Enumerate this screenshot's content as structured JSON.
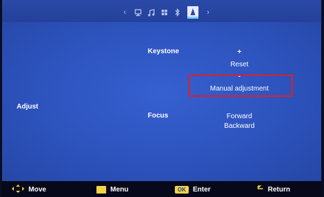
{
  "colors": {
    "background": "#2d53bd",
    "highlight_border": "#e01e28",
    "key_yellow": "#f4d24a"
  },
  "topbar": {
    "icons": [
      "left-arrow-icon",
      "monitor-icon",
      "music-note-icon",
      "grid-icon",
      "bluetooth-icon",
      "projector-icon",
      "right-arrow-icon"
    ],
    "left_arrow": "‹",
    "right_arrow": "›"
  },
  "panel": {
    "section_label": "Adjust",
    "keystone": {
      "label": "Keystone",
      "plus": "+",
      "reset": "Reset",
      "minus": "-",
      "manual": "Manual adjustment"
    },
    "focus": {
      "label": "Focus",
      "forward": "Forward",
      "backward": "Backward"
    }
  },
  "footer": {
    "move": "Move",
    "menu": "Menu",
    "ok_key": "OK",
    "enter": "Enter",
    "return": "Return"
  }
}
